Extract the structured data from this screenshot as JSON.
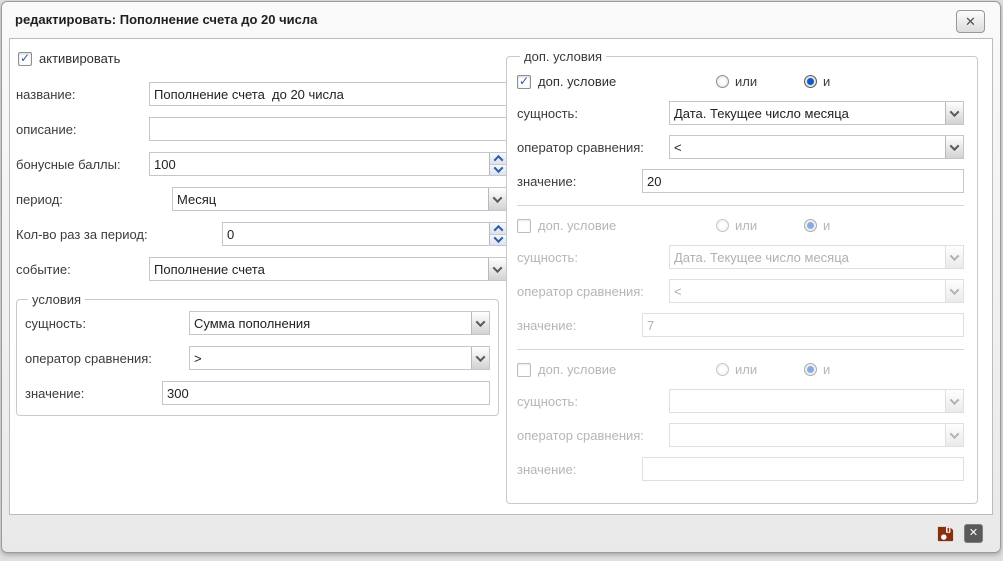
{
  "window": {
    "title": "редактировать: Пополнение счета до 20 числа",
    "close_icon": "✕"
  },
  "form": {
    "activate": {
      "label": "активировать",
      "checked": true
    },
    "name": {
      "label": "название:",
      "value": "Пополнение счета  до 20 числа"
    },
    "description": {
      "label": "описание:",
      "value": ""
    },
    "bonus": {
      "label": "бонусные баллы:",
      "value": "100"
    },
    "period": {
      "label": "период:",
      "value": "Месяц"
    },
    "times": {
      "label": "Кол-во раз за период:",
      "value": "0"
    },
    "event": {
      "label": "событие:",
      "value": "Пополнение счета"
    },
    "conditions": {
      "legend": "условия",
      "entity_label": "сущность:",
      "entity_value": "Сумма пополнения",
      "operator_label": "оператор сравнения:",
      "operator_value": ">",
      "value_label": "значение:",
      "value_value": "300"
    }
  },
  "extra": {
    "legend": "доп. условия",
    "checkbox_label": "доп. условие",
    "or_label": "или",
    "and_label": "и",
    "entity_label": "сущность:",
    "operator_label": "оператор сравнения:",
    "value_label": "значение:",
    "groups": [
      {
        "checked": true,
        "enabled": true,
        "or_checked": false,
        "and_checked": true,
        "entity": "Дата. Текущее число месяца",
        "operator": "<",
        "value": "20"
      },
      {
        "checked": false,
        "enabled": false,
        "or_checked": false,
        "and_checked": true,
        "entity": "Дата. Текущее число месяца",
        "operator": "<",
        "value": "7"
      },
      {
        "checked": false,
        "enabled": false,
        "or_checked": false,
        "and_checked": true,
        "entity": "",
        "operator": "",
        "value": ""
      }
    ]
  },
  "footer": {
    "save_tooltip": "сохранить",
    "close_tooltip": "закрыть",
    "close_glyph": "✕"
  },
  "colors": {
    "save_icon": "#8c2e0e",
    "close_icon_bg": "#5a5a5a",
    "radio_dot": "#0f5cc8",
    "check_mark": "#2b57a5",
    "spinner_arrow": "#2d5ca8"
  }
}
